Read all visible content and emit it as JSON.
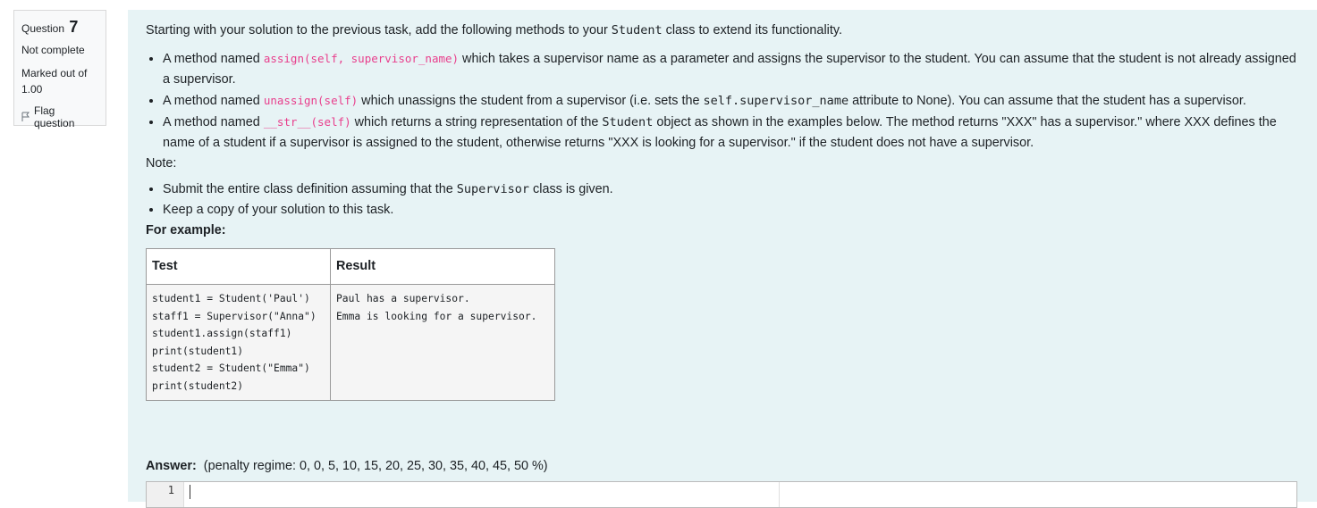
{
  "info": {
    "question_label": "Question",
    "question_number": "7",
    "state": "Not complete",
    "grade_line1": "Marked out of",
    "grade_line2": "1.00",
    "flag_label": "Flag question"
  },
  "content": {
    "intro_a": "Starting with your solution to the previous task, add the following methods to your ",
    "intro_code": "Student",
    "intro_b": " class to extend its functionality.",
    "b1_a": "A method named ",
    "b1_code": "assign(self, supervisor_name)",
    "b1_b": " which takes a supervisor name as a parameter and assigns the supervisor to the student. You can assume that the student is not already assigned a supervisor.",
    "b2_a": "A method named ",
    "b2_code": "unassign(self)",
    "b2_b": " which unassigns the student from a supervisor (i.e. sets the ",
    "b2_mono": "self.supervisor_name",
    "b2_c": " attribute to None). You can assume that the student has a supervisor.",
    "b3_a": "A method named ",
    "b3_code": "__str__(self)",
    "b3_b": " which returns a string representation of the ",
    "b3_mono": "Student",
    "b3_c": " object as shown in the examples below. The method returns \"XXX\" has a supervisor.\" where XXX defines the name of a student if a supervisor is assigned to the student, otherwise returns \"XXX is looking for a supervisor.\" if the student does not have a supervisor.",
    "note_title": "Note:",
    "n1_a": "Submit the entire class definition assuming that the ",
    "n1_mono": "Supervisor",
    "n1_b": " class is given.",
    "n2": "Keep a copy of your solution to this task.",
    "for_example": "For example:",
    "table": {
      "headers": [
        "Test",
        "Result"
      ],
      "test": "student1 = Student('Paul')\nstaff1 = Supervisor(\"Anna\")\nstudent1.assign(staff1)\nprint(student1)\nstudent2 = Student(\"Emma\")\nprint(student2)",
      "result": "Paul has a supervisor.\nEmma is looking for a supervisor."
    },
    "answer_label": "Answer:",
    "penalty": "(penalty regime: 0, 0, 5, 10, 15, 20, 25, 30, 35, 40, 45, 50 %)",
    "editor_line_number": "1"
  }
}
